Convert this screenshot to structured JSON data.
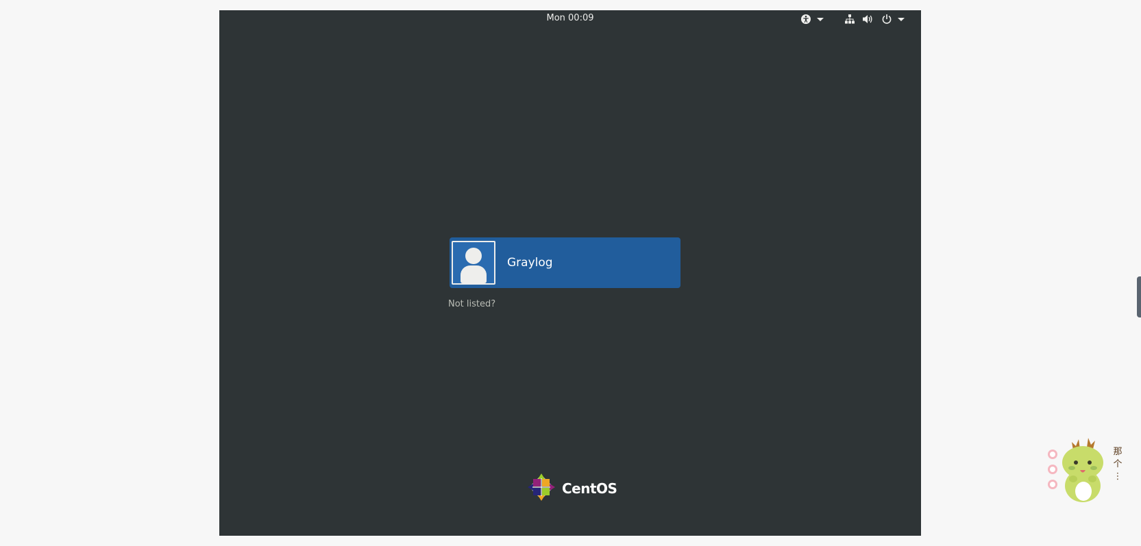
{
  "top_bar": {
    "clock": "Mon 00:09",
    "icons": [
      "accessibility-icon",
      "network-icon",
      "volume-icon",
      "power-icon"
    ]
  },
  "user_list": {
    "users": [
      {
        "name": "Graylog",
        "avatar": "default-user-avatar-icon"
      }
    ],
    "not_listed_label": "Not listed?"
  },
  "branding": {
    "logo_text": "CentOS"
  },
  "sticker": {
    "label": "那\n个\n⋮"
  },
  "colors": {
    "screen_bg": "#2e3436",
    "user_button": "#215d9c",
    "page_bg": "#f7f7f7"
  }
}
